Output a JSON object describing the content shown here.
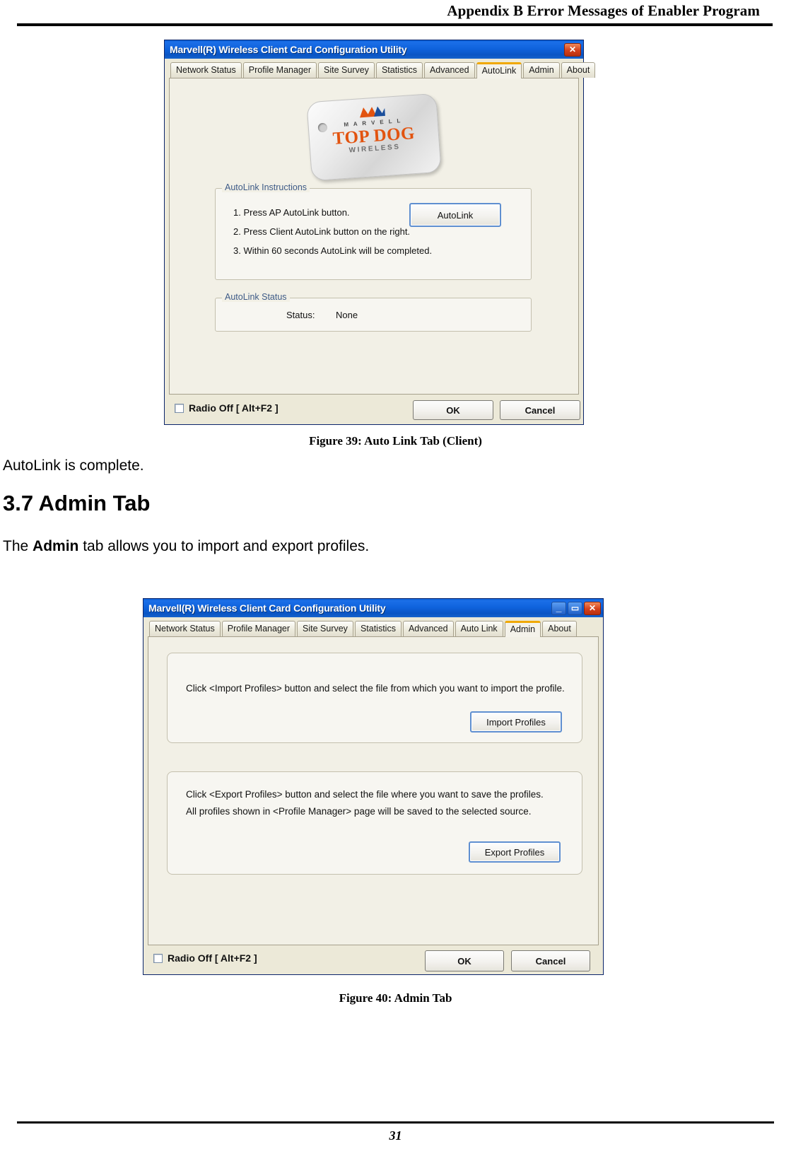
{
  "header": {
    "running_title": "Appendix B Error Messages of Enabler Program"
  },
  "footer": {
    "page_number": "31"
  },
  "body": {
    "para_after_fig39": "AutoLink is complete.",
    "section_heading": "3.7 Admin Tab",
    "para_admin_1": "The ",
    "para_admin_bold": "Admin",
    "para_admin_2": " tab allows you to import and export profiles."
  },
  "figure39": {
    "caption": "Figure 39: Auto Link Tab (Client)",
    "window": {
      "title": "Marvell(R) Wireless Client Card Configuration Utility",
      "controls": {
        "close": "✕"
      },
      "tabs": [
        {
          "label": "Network Status",
          "active": false
        },
        {
          "label": "Profile Manager",
          "active": false
        },
        {
          "label": "Site Survey",
          "active": false
        },
        {
          "label": "Statistics",
          "active": false
        },
        {
          "label": "Advanced",
          "active": false
        },
        {
          "label": "AutoLink",
          "active": true
        },
        {
          "label": "Admin",
          "active": false
        },
        {
          "label": "About",
          "active": false
        }
      ],
      "logo": {
        "brand": "M A R V E L L",
        "top_line": "TOP DOG",
        "bottom_line": "WIRELESS"
      },
      "instructions_group": {
        "label": "AutoLink Instructions",
        "steps": [
          "1. Press AP AutoLink button.",
          "2. Press Client AutoLink button on the right.",
          "3. Within 60 seconds AutoLink will be completed."
        ],
        "button_label": "AutoLink"
      },
      "status_group": {
        "label": "AutoLink Status",
        "status_label": "Status:",
        "status_value": "None"
      },
      "footer_bar": {
        "radio_off_label": "Radio Off  [ Alt+F2 ]",
        "radio_off_checked": false,
        "ok_label": "OK",
        "cancel_label": "Cancel"
      }
    }
  },
  "figure40": {
    "caption": "Figure 40: Admin Tab",
    "window": {
      "title": "Marvell(R) Wireless Client Card Configuration Utility",
      "controls": {
        "minimize": "_",
        "maximize": "▭",
        "close": "✕"
      },
      "tabs": [
        {
          "label": "Network Status",
          "active": false
        },
        {
          "label": "Profile Manager",
          "active": false
        },
        {
          "label": "Site Survey",
          "active": false
        },
        {
          "label": "Statistics",
          "active": false
        },
        {
          "label": "Advanced",
          "active": false
        },
        {
          "label": "Auto Link",
          "active": false
        },
        {
          "label": "Admin",
          "active": true
        },
        {
          "label": "About",
          "active": false
        }
      ],
      "import_group": {
        "text": "Click <Import Profiles> button and select the file from which you want to import the profile.",
        "button_label": "Import Profiles"
      },
      "export_group": {
        "line1": "Click <Export Profiles> button and select the file where you want to save the profiles.",
        "line2": "All profiles shown in <Profile Manager> page will be saved to the selected source.",
        "button_label": "Export Profiles"
      },
      "footer_bar": {
        "radio_off_label": "Radio Off  [ Alt+F2 ]",
        "radio_off_checked": false,
        "ok_label": "OK",
        "cancel_label": "Cancel"
      }
    }
  },
  "colors": {
    "titlebar_blue": "#0f63dd",
    "dialog_face": "#ece9d8",
    "active_tab_accent": "#f0a800",
    "group_label_blue": "#3d5a86",
    "logo_orange": "#e2530f"
  }
}
